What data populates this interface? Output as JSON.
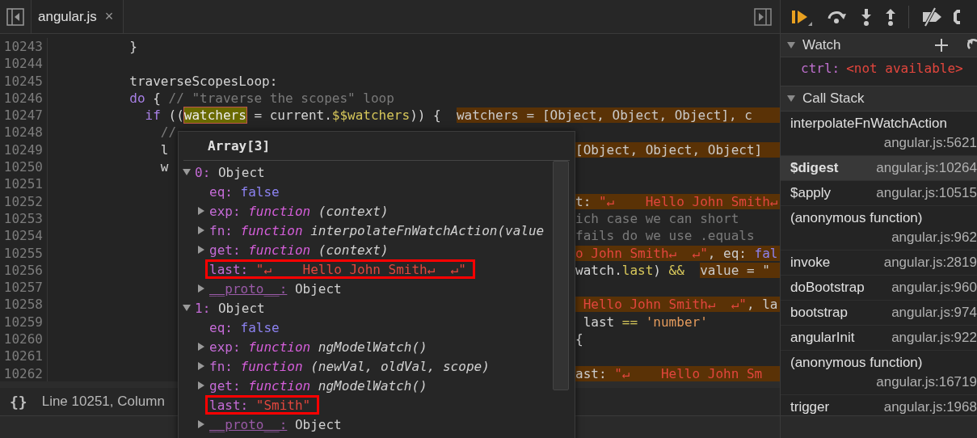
{
  "editor": {
    "tabs": [
      {
        "label": "angular.js",
        "close": "×",
        "selected": true
      }
    ],
    "lines": [
      {
        "number": "10243",
        "left": [
          {
            "kind": "plain",
            "text": "          }"
          }
        ]
      },
      {
        "number": "10244"
      },
      {
        "number": "10245",
        "left": [
          {
            "kind": "plain",
            "text": "          traverseScopesLoop:"
          }
        ]
      },
      {
        "number": "10246",
        "left": [
          {
            "kind": "keyword",
            "text": "          do"
          },
          {
            "kind": "plain",
            "text": " {"
          },
          {
            "kind": "comment",
            "text": " // \"traverse the scopes\" loop"
          }
        ]
      },
      {
        "number": "10247",
        "left": [
          {
            "kind": "keyword",
            "text": "            if"
          },
          {
            "kind": "plain",
            "text": " (("
          },
          {
            "kind": "highlight",
            "text": "watchers"
          },
          {
            "kind": "plain",
            "text": " = current."
          },
          {
            "kind": "property",
            "text": "$$watchers"
          },
          {
            "kind": "plain",
            "text": ")) {"
          },
          {
            "kind": "badge",
            "parts": [
              {
                "kind": "plain",
                "text": "watchers = [Object, Object, Object], c"
              }
            ]
          }
        ]
      },
      {
        "number": "10248",
        "left": [
          {
            "kind": "comment",
            "text": "              //"
          }
        ]
      },
      {
        "number": "10249",
        "left": [
          {
            "kind": "plain",
            "text": "              l"
          }
        ],
        "right": [
          {
            "kind": "badge",
            "parts": [
              {
                "kind": "plain",
                "text": "[Object, Object, Object]"
              }
            ]
          }
        ]
      },
      {
        "number": "10250",
        "left": [
          {
            "kind": "plain",
            "text": "              w"
          }
        ]
      },
      {
        "number": "10251"
      },
      {
        "number": "10252",
        "right": [
          {
            "kind": "badge",
            "parts": [
              {
                "kind": "plain",
                "text": "t: "
              },
              {
                "kind": "string",
                "text": "\"↵    Hello John Smith↵"
              }
            ]
          }
        ]
      },
      {
        "number": "10253",
        "right": [
          {
            "kind": "comment",
            "text": "ich case we can short"
          }
        ]
      },
      {
        "number": "10254",
        "right": [
          {
            "kind": "comment",
            "text": "fails do we use .equals"
          }
        ]
      },
      {
        "number": "10255",
        "right": [
          {
            "kind": "badge",
            "parts": [
              {
                "kind": "string",
                "text": "o John Smith↵  ↵\""
              },
              {
                "kind": "plain",
                "text": ", eq: "
              },
              {
                "kind": "bool",
                "text": "fal"
              }
            ]
          }
        ]
      },
      {
        "number": "10256",
        "right": [
          {
            "kind": "plain",
            "text": "watch."
          },
          {
            "kind": "property",
            "text": "last"
          },
          {
            "kind": "plain",
            "text": ") "
          },
          {
            "kind": "property",
            "text": "&&"
          },
          {
            "kind": "badge",
            "parts": [
              {
                "kind": "plain",
                "text": "value = \""
              }
            ]
          }
        ]
      },
      {
        "number": "10257"
      },
      {
        "number": "10258",
        "right": [
          {
            "kind": "badge",
            "parts": [
              {
                "kind": "string",
                "text": " Hello John Smith↵  ↵\""
              },
              {
                "kind": "plain",
                "text": ", la"
              }
            ]
          }
        ]
      },
      {
        "number": "10259",
        "right": [
          {
            "kind": "plain",
            "text": " last "
          },
          {
            "kind": "property",
            "text": "=="
          },
          {
            "kind": "literal",
            "text": " 'number'"
          }
        ]
      },
      {
        "number": "10260",
        "right": [
          {
            "kind": "plain",
            "text": "{"
          }
        ]
      },
      {
        "number": "10261"
      },
      {
        "number": "10262",
        "right": [
          {
            "kind": "badge",
            "parts": [
              {
                "kind": "plain",
                "text": "ast: "
              },
              {
                "kind": "string",
                "text": "\"↵    Hello John Sm"
              }
            ]
          }
        ]
      }
    ],
    "status": {
      "pretty_print": "{}",
      "position": "Line 10251, Column"
    }
  },
  "popover": {
    "title": "Array[3]",
    "items": [
      {
        "key": "0:",
        "value": "Object",
        "expanded": true,
        "children": [
          {
            "key": "eq:",
            "kind": "boolean",
            "value": "false",
            "highlighted": false,
            "dimmed": false
          },
          {
            "key": "exp:",
            "kind": "function",
            "keyword": "function",
            "value": "(context)",
            "expanded": false,
            "highlighted": false,
            "dimmed": false
          },
          {
            "key": "fn:",
            "kind": "function",
            "keyword": "function",
            "value": "interpolateFnWatchAction(value",
            "expanded": false,
            "highlighted": false,
            "dimmed": false
          },
          {
            "key": "get:",
            "kind": "function",
            "keyword": "function",
            "value": "(context)",
            "expanded": false,
            "highlighted": false,
            "dimmed": false
          },
          {
            "key": "last:",
            "kind": "string",
            "value": "\"↵    Hello John Smith↵  ↵\"",
            "highlighted": true,
            "dimmed": false
          },
          {
            "key": "__proto__:",
            "kind": "object",
            "value": "Object",
            "expanded": false,
            "highlighted": false,
            "dimmed": true
          }
        ]
      },
      {
        "key": "1:",
        "value": "Object",
        "expanded": true,
        "children": [
          {
            "key": "eq:",
            "kind": "boolean",
            "value": "false",
            "highlighted": false,
            "dimmed": false
          },
          {
            "key": "exp:",
            "kind": "function",
            "keyword": "function",
            "value": "ngModelWatch()",
            "expanded": false,
            "highlighted": false,
            "dimmed": false
          },
          {
            "key": "fn:",
            "kind": "function",
            "keyword": "function",
            "value": "(newVal, oldVal, scope)",
            "expanded": false,
            "highlighted": false,
            "dimmed": false
          },
          {
            "key": "get:",
            "kind": "function",
            "keyword": "function",
            "value": "ngModelWatch()",
            "expanded": false,
            "highlighted": false,
            "dimmed": false
          },
          {
            "key": "last:",
            "kind": "string",
            "value": "\"Smith\"",
            "highlighted": true,
            "dimmed": false
          },
          {
            "key": "__proto__:",
            "kind": "object",
            "value": "Object",
            "expanded": false,
            "highlighted": false,
            "dimmed": true
          }
        ]
      }
    ]
  },
  "debugger": {
    "watch": {
      "title": "Watch",
      "expanded": true,
      "items": [
        {
          "name": "ctrl:",
          "value": "<not available>"
        }
      ]
    },
    "call_stack": {
      "title": "Call Stack",
      "expanded": true,
      "frames": [
        {
          "name": "interpolateFnWatchAction",
          "location": "angular.js:5621",
          "selected": false
        },
        {
          "name": "$digest",
          "location": "angular.js:10264",
          "selected": true
        },
        {
          "name": "$apply",
          "location": "angular.js:10515",
          "selected": false
        },
        {
          "name": "(anonymous function)",
          "location": "angular.js:962",
          "selected": false
        },
        {
          "name": "invoke",
          "location": "angular.js:2819",
          "selected": false
        },
        {
          "name": "doBootstrap",
          "location": "angular.js:960",
          "selected": false
        },
        {
          "name": "bootstrap",
          "location": "angular.js:974",
          "selected": false
        },
        {
          "name": "angularInit",
          "location": "angular.js:922",
          "selected": false
        },
        {
          "name": "(anonymous function)",
          "location": "angular.js:16719",
          "selected": false
        },
        {
          "name": "trigger",
          "location": "angular.js:1968",
          "selected": false
        }
      ]
    }
  }
}
